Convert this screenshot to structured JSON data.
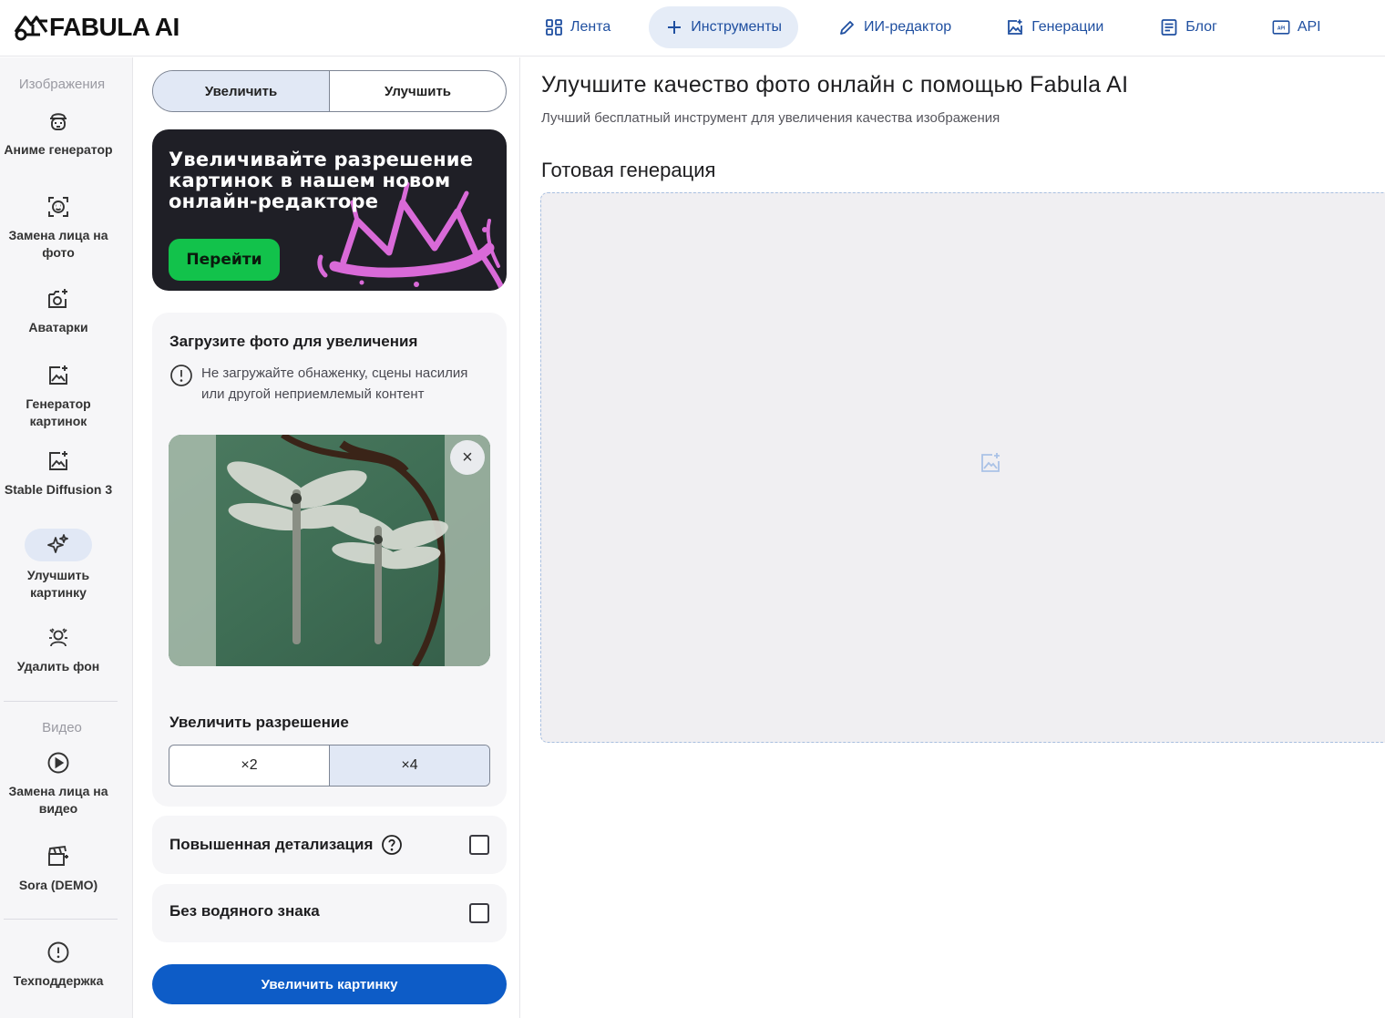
{
  "app": {
    "logo_text": "FABULA AI",
    "brand_color": "#1f4fa0",
    "accent_color": "#0d5cc7",
    "active_bg": "#e1e8f5"
  },
  "nav": {
    "items": [
      {
        "label": "Лента",
        "icon": "grid-icon",
        "active": false
      },
      {
        "label": "Инструменты",
        "icon": "plus-icon",
        "active": true
      },
      {
        "label": "ИИ-редактор",
        "icon": "pencil-icon",
        "active": false
      },
      {
        "label": "Генерации",
        "icon": "image-plus-icon",
        "active": false
      },
      {
        "label": "Блог",
        "icon": "document-icon",
        "active": false
      },
      {
        "label": "API",
        "icon": "api-icon",
        "active": false
      }
    ]
  },
  "sidebar": {
    "section_images": "Изображения",
    "section_video": "Видео",
    "items": [
      {
        "label": "Аниме генератор",
        "icon": "anime-face-icon"
      },
      {
        "label": "Замена лица на фото",
        "icon": "face-scan-icon"
      },
      {
        "label": "Аватарки",
        "icon": "camera-plus-icon"
      },
      {
        "label": "Генератор картинок",
        "icon": "image-generate-icon"
      },
      {
        "label": "Stable Diffusion 3",
        "icon": "image-plus-icon"
      },
      {
        "label": "Улучшить картинку",
        "icon": "sparkles-icon",
        "active": true
      },
      {
        "label": "Удалить фон",
        "icon": "remove-bg-icon"
      },
      {
        "label": "Замена лица на видео",
        "icon": "play-circle-icon"
      },
      {
        "label": "Sora (DEMO)",
        "icon": "clapperboard-icon"
      },
      {
        "label": "Техподдержка",
        "icon": "alert-circle-icon"
      }
    ]
  },
  "panel": {
    "mode_tabs": [
      {
        "label": "Увеличить",
        "active": true
      },
      {
        "label": "Улучшить",
        "active": false
      }
    ],
    "banner": {
      "text": "Увеличивайте разрешение картинок в нашем новом онлайн-редакторе",
      "button": "Перейти"
    },
    "upload": {
      "title": "Загрузите фото для увеличения",
      "warning": "Не загружайте обнаженку, сцены насилия или другой неприемлемый контент",
      "remove_label": "×"
    },
    "resolution": {
      "title": "Увеличить разрешение",
      "options": [
        {
          "label": "×2",
          "active": false
        },
        {
          "label": "×4",
          "active": true
        }
      ]
    },
    "options": [
      {
        "label": "Повышенная детализация",
        "checked": false,
        "help": true
      },
      {
        "label": "Без водяного знака",
        "checked": false,
        "help": false
      }
    ],
    "submit": "Увеличить картинку"
  },
  "main": {
    "title": "Улучшите качество фото онлайн с помощью Fabula AI",
    "subtitle": "Лучший бесплатный инструмент для увеличения качества изображения",
    "result_title": "Готовая генерация"
  }
}
